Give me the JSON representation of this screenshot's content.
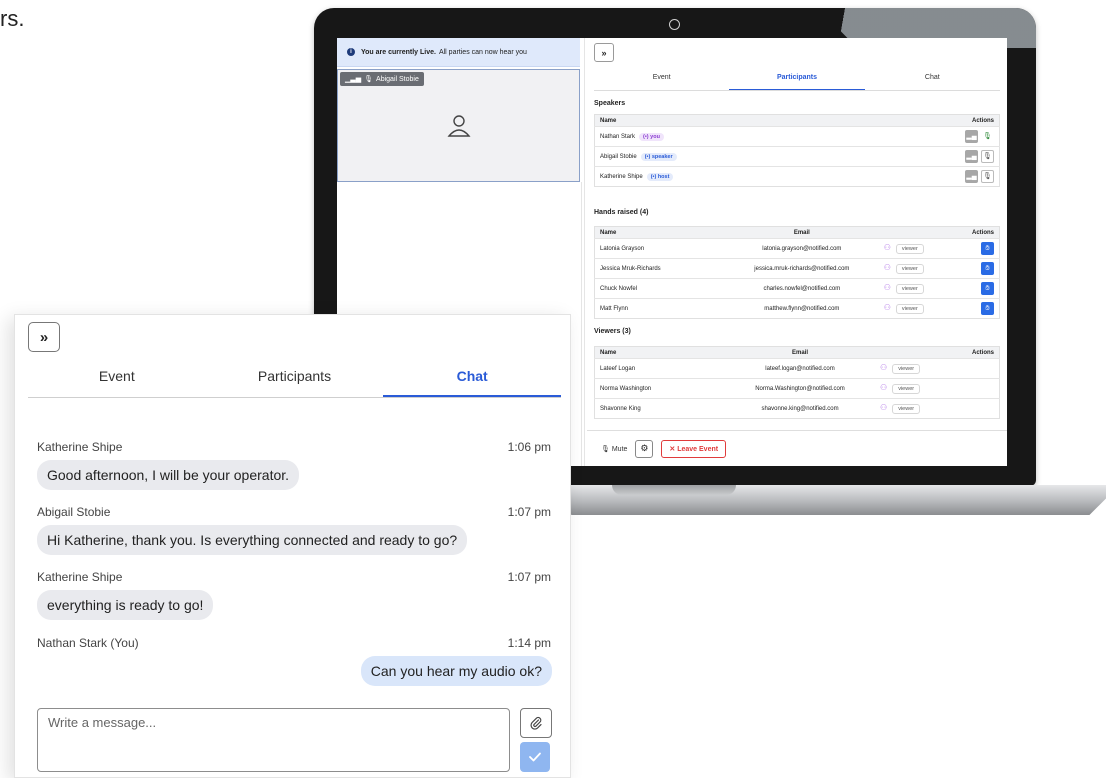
{
  "fragment_text": "rs.",
  "laptop": {
    "banner_bold": "You are currently Live.",
    "banner_text": "All parties can now hear you",
    "tile_name": "Abigail Stobie",
    "collapse_label": "»",
    "tabs": [
      "Event",
      "Participants",
      "Chat"
    ],
    "speakers": {
      "title": "Speakers",
      "col_name": "Name",
      "col_actions": "Actions",
      "rows": [
        {
          "name": "Nathan Stark",
          "tag": "(•) you"
        },
        {
          "name": "Abigail Stobie",
          "tag": "(•) speaker"
        },
        {
          "name": "Katherine Shipe",
          "tag": "(•) host"
        }
      ]
    },
    "hands": {
      "title": "Hands raised (4)",
      "col_name": "Name",
      "col_email": "Email",
      "col_actions": "Actions",
      "rows": [
        {
          "name": "Latonia Grayson",
          "email": "latonia.grayson@notified.com",
          "role": "viewer"
        },
        {
          "name": "Jessica Mruk-Richards",
          "email": "jessica.mruk-richards@notified.com",
          "role": "viewer"
        },
        {
          "name": "Chuck Nowfel",
          "email": "charles.nowfel@notified.com",
          "role": "viewer"
        },
        {
          "name": "Matt Flynn",
          "email": "matthew.flynn@notified.com",
          "role": "viewer"
        }
      ]
    },
    "viewers": {
      "title": "Viewers (3)",
      "col_name": "Name",
      "col_email": "Email",
      "col_actions": "Actions",
      "rows": [
        {
          "name": "Lateef Logan",
          "email": "lateef.logan@notified.com",
          "role": "viewer"
        },
        {
          "name": "Norma Washington",
          "email": "Norma.Washington@notified.com",
          "role": "viewer"
        },
        {
          "name": "Shavonne King",
          "email": "shavonne.king@notified.com",
          "role": "viewer"
        }
      ]
    },
    "footer": {
      "mute": "Mute",
      "leave": "Leave Event"
    }
  },
  "chat": {
    "collapse_label": "»",
    "tabs": [
      "Event",
      "Participants",
      "Chat"
    ],
    "active_tab": "Chat",
    "messages": [
      {
        "sender": "Katherine Shipe",
        "time": "1:06 pm",
        "text": "Good afternoon, I will be your operator.",
        "mine": false
      },
      {
        "sender": "Abigail Stobie",
        "time": "1:07 pm",
        "text": "Hi Katherine, thank you. Is everything connected and ready to go?",
        "mine": false
      },
      {
        "sender": "Katherine Shipe",
        "time": "1:07 pm",
        "text": "everything is ready to go!",
        "mine": false
      },
      {
        "sender": "Nathan Stark (You)",
        "time": "1:14 pm",
        "text": "Can you hear my audio ok?",
        "mine": true
      }
    ],
    "composer_placeholder": "Write a message..."
  },
  "colors": {
    "accent": "#2a5bd7",
    "hand_button": "#2a6be5",
    "leave": "#e03b3b",
    "send_button": "#8fb6f0"
  }
}
